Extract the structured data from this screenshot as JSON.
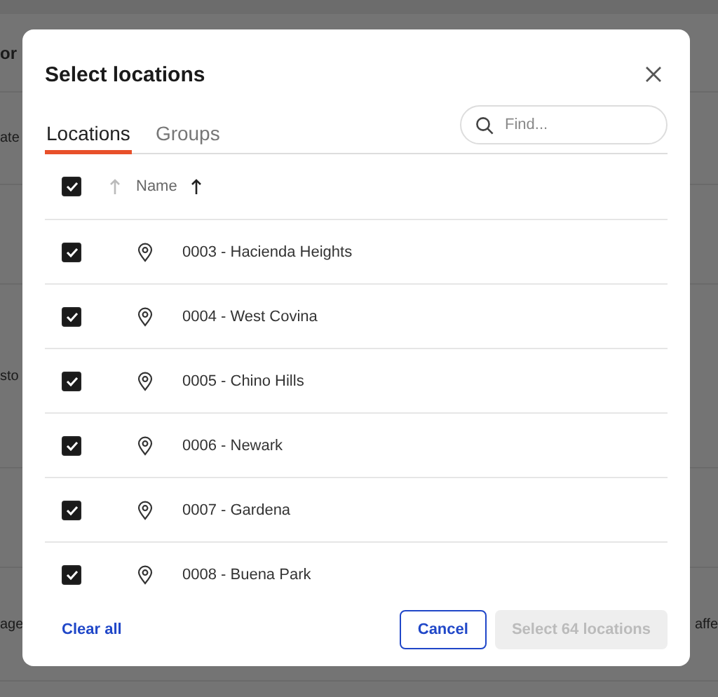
{
  "background_page": {
    "left_fragments": [
      "or",
      "ate",
      "sto",
      "age"
    ],
    "right_fragments": [
      "affe"
    ]
  },
  "dialog": {
    "title": "Select locations",
    "tabs": [
      {
        "label": "Locations",
        "selected": true
      },
      {
        "label": "Groups",
        "selected": false
      }
    ],
    "search": {
      "placeholder": "Find..."
    },
    "table": {
      "select_all_checked": true,
      "columns": [
        {
          "kind": "icon",
          "sort_active": false
        },
        {
          "kind": "text",
          "label": "Name",
          "sort_active": true
        }
      ],
      "rows": [
        {
          "name": "0003 - Hacienda Heights",
          "checked": true
        },
        {
          "name": "0004 - West Covina",
          "checked": true
        },
        {
          "name": "0005 - Chino Hills",
          "checked": true
        },
        {
          "name": "0006 - Newark",
          "checked": true
        },
        {
          "name": "0007 - Gardena",
          "checked": true
        },
        {
          "name": "0008 - Buena Park",
          "checked": true
        }
      ]
    },
    "footer": {
      "clear_link": "Clear all",
      "buttons": [
        {
          "kind": "secondary",
          "label": "Cancel",
          "disabled": false
        },
        {
          "kind": "primary",
          "label": "Select 64 locations",
          "disabled": true
        }
      ]
    }
  }
}
